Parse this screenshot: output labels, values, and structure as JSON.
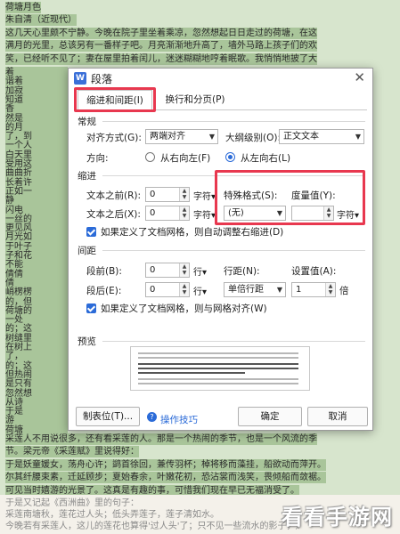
{
  "document": {
    "top_lines": [
      "荷塘月色",
      "朱自清（近现代）",
      "这几天心里颇不宁静。今晚在院子里坐着乘凉，忽然想起日日走过的荷塘，在这",
      "满月的光里，总该另有一番样子吧。月亮渐渐地升高了，墙外马路上孩子们的欢",
      "笑，已经听不见了；妻在屋里拍着闰儿，迷迷糊糊地哼着眠歌。我悄悄地披了大"
    ],
    "left_fragments": [
      "着",
      "谐着",
      "加寂",
      "知道",
      "香",
      "然是",
      "的月",
      "了，到",
      "一个人",
      "白天里",
      "受用这",
      "曲曲折",
      "长着许",
      "正如一",
      "静",
      "闪电",
      "一丝的",
      "更见风",
      "月光如",
      "于叶子",
      "子和花",
      "不能",
      "倩倩",
      "倩",
      "峭楞楞",
      "的，但",
      "荷塘的",
      "一处",
      "的；这",
      "树缝里",
      "在树上",
      "了，",
      "的；这",
      "但热闹",
      "是只有",
      "忽然想",
      "从诗",
      "于是",
      "游",
      "荷塘"
    ],
    "bottom_lines": [
      "采莲人不用说很多，还有看采莲的人。那是一个热闹的季节，也是一个风流的季",
      "节。梁元帝《采莲赋》里说得好：",
      "于是妖童媛女，荡舟心许；鹢首徐回，兼传羽杯；棹将移而藻挂，船欲动而萍开。",
      "尔其纤腰束素，迁延顾步；夏始春余，叶嫩花初，恐沾裳而浅笑，畏倾船而敛裾。",
      "可见当时嬉游的光景了。这真是有趣的事，可惜我们现在早已无福消受了。",
      "于是又记起《西洲曲》里的句子：",
      "采莲南塘秋，莲花过人头；低头弄莲子，莲子清如水。",
      "今晚若有采莲人，这儿的莲花也算得'过人头'了；只不见一些流水的影子，是不行"
    ]
  },
  "watermark": "看看手游网",
  "dialog": {
    "title": "段落",
    "tabs": [
      "缩进和间距(I)",
      "换行和分页(P)"
    ],
    "general": {
      "section": "常规",
      "alignment_label": "对齐方式(G):",
      "alignment_value": "两端对齐",
      "outline_label": "大纲级别(O):",
      "outline_value": "正文文本",
      "direction_label": "方向:",
      "rtl_label": "从右向左(F)",
      "ltr_label": "从左向右(L)"
    },
    "indent": {
      "section": "缩进",
      "before_label": "文本之前(R):",
      "before_value": "0",
      "after_label": "文本之后(X):",
      "after_value": "0",
      "unit": "字符",
      "special_label": "特殊格式(S):",
      "special_value": "(无)",
      "measure_label": "度量值(Y):",
      "measure_value": "",
      "measure_unit": "字符",
      "grid_check": "如果定义了文档网格，则自动调整右缩进(D)"
    },
    "spacing": {
      "section": "间距",
      "before_label": "段前(B):",
      "before_value": "0",
      "after_label": "段后(E):",
      "after_value": "0",
      "unit": "行",
      "line_label": "行距(N):",
      "line_value": "单倍行距",
      "set_label": "设置值(A):",
      "set_value": "1",
      "set_unit": "倍",
      "grid_check": "如果定义了文档网格，则与网格对齐(W)"
    },
    "preview": {
      "section": "预览"
    },
    "buttons": {
      "tabs": "制表位(T)...",
      "tips": "操作技巧",
      "ok": "确定",
      "cancel": "取消"
    }
  },
  "colors": {
    "highlight": "#a9c59a",
    "page": "#d7e5cd",
    "accent": "#2b6bd8",
    "annotation": "#e8384f"
  }
}
